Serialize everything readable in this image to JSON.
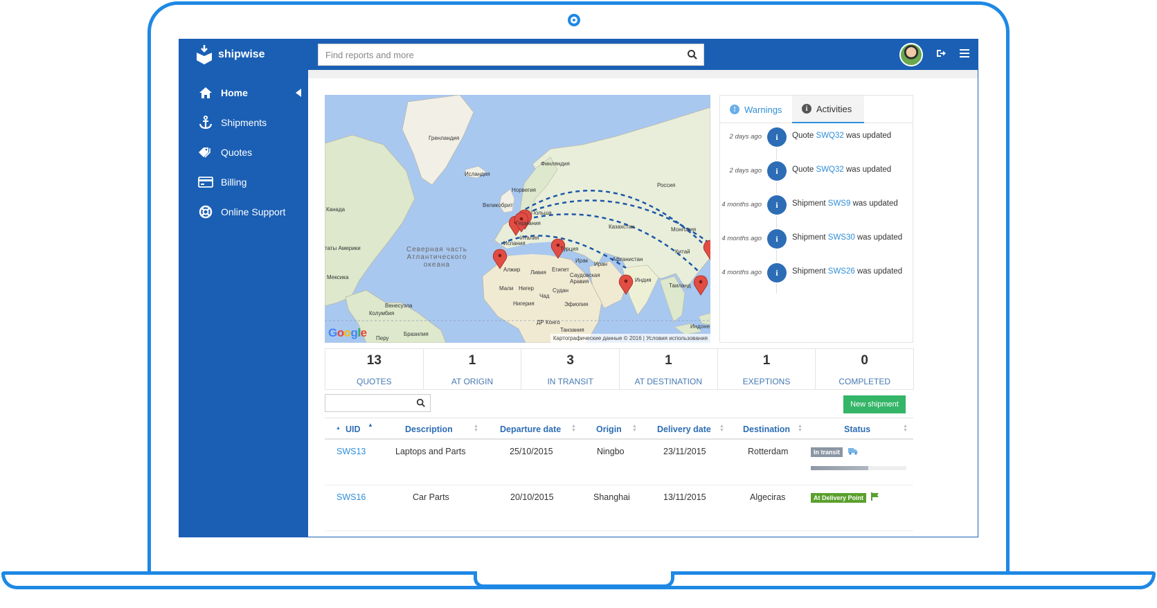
{
  "app": {
    "name": "shipwise"
  },
  "search": {
    "placeholder": "Find reports and more"
  },
  "sidebar": {
    "items": [
      {
        "label": "Home",
        "icon": "home-icon",
        "active": true
      },
      {
        "label": "Shipments",
        "icon": "anchor-icon",
        "active": false
      },
      {
        "label": "Quotes",
        "icon": "tag-icon",
        "active": false
      },
      {
        "label": "Billing",
        "icon": "credit-card-icon",
        "active": false
      },
      {
        "label": "Online Support",
        "icon": "lifebuoy-icon",
        "active": false
      }
    ]
  },
  "map": {
    "labels": {
      "greenland": "Гренландия",
      "iceland": "Исландия",
      "finland": "Финляндия",
      "norway": "Норвегия",
      "russia": "Россия",
      "uk": "Великобрит",
      "poland": "Польша",
      "germany": "Германия",
      "kazakhstan": "Казахстан",
      "mongolia": "Монголия",
      "italy": "Италия",
      "turkey": "Турция",
      "canada": "Канада",
      "usa": "таты Америки",
      "ocean": "Северная часть\nАтлантического\nокеана",
      "algeria": "Алжир",
      "libya": "Ливия",
      "egypt": "Египет",
      "iraq": "Ирак",
      "iran": "Иран",
      "afghanistan": "Афганистан",
      "china": "Китай",
      "saudi": "Саудовская\nАравия",
      "india": "Индия",
      "thailand": "Таиланд",
      "mexico": "Мексика",
      "mali": "Мали",
      "niger": "Нигер",
      "chad": "Чад",
      "sudan": "Судан",
      "ethiopia": "Эфиопия",
      "nigeria": "Нигерия",
      "venezuela": "Венесуэла",
      "colombia": "Колумбия",
      "drc": "ДР Конго",
      "tanzania": "Танзания",
      "brazil": "Бразилия",
      "peru": "Перу",
      "indonesia": "Индоне",
      "spain": "Испания"
    },
    "google": "Google",
    "credit": "Картографические данные © 2016 | Условия использования"
  },
  "activity": {
    "tabs": {
      "warnings": "Warnings",
      "activities": "Activities"
    },
    "items": [
      {
        "time": "2 days ago",
        "prefix": "Quote ",
        "ref": "SWQ32",
        "suffix": " was updated"
      },
      {
        "time": "2 days ago",
        "prefix": "Quote ",
        "ref": "SWQ32",
        "suffix": " was updated"
      },
      {
        "time": "4 months ago",
        "prefix": "Shipment ",
        "ref": "SWS9",
        "suffix": " was updated"
      },
      {
        "time": "4 months ago",
        "prefix": "Shipment ",
        "ref": "SWS30",
        "suffix": " was updated"
      },
      {
        "time": "4 months ago",
        "prefix": "Shipment ",
        "ref": "SWS26",
        "suffix": " was updated"
      }
    ]
  },
  "stats": [
    {
      "value": "13",
      "label": "QUOTES"
    },
    {
      "value": "1",
      "label": "AT ORIGIN"
    },
    {
      "value": "3",
      "label": "IN TRANSIT"
    },
    {
      "value": "1",
      "label": "AT DESTINATION"
    },
    {
      "value": "1",
      "label": "EXEPTIONS"
    },
    {
      "value": "0",
      "label": "COMPLETED"
    }
  ],
  "table": {
    "new_button": "New shipment",
    "columns": [
      "UID",
      "Description",
      "Departure date",
      "Origin",
      "Delivery date",
      "Destination",
      "Status"
    ],
    "rows": [
      {
        "uid": "SWS13",
        "description": "Laptops and Parts",
        "departure": "25/10/2015",
        "origin": "Ningbo",
        "delivery": "23/11/2015",
        "destination": "Rotterdam",
        "status": "In transit",
        "status_color": "#8a96a3",
        "progress": 0.6
      },
      {
        "uid": "SWS16",
        "description": "Car Parts",
        "departure": "20/10/2015",
        "origin": "Shanghai",
        "delivery": "13/11/2015",
        "destination": "Algeciras",
        "status": "At Delivery Point",
        "status_color": "#5aa02c"
      }
    ]
  },
  "colors": {
    "brand": "#1a5fb4",
    "accent": "#2f8ed8",
    "success": "#34b567",
    "frame": "#1e88e5"
  }
}
